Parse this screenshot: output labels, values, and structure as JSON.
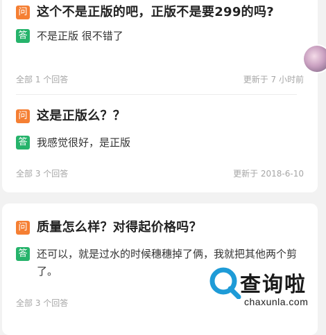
{
  "labels": {
    "question_tag": "问",
    "answer_tag": "答"
  },
  "questions": [
    {
      "question": "这个不是正版的吧，正版不是要299的吗?",
      "answer": "不是正版 很不错了",
      "answer_count": "全部 1 个回答",
      "updated": "更新于 7 小时前"
    },
    {
      "question": "这是正版么？？",
      "answer": "我感觉很好，是正版",
      "answer_count": "全部 3 个回答",
      "updated": "更新于 2018-6-10"
    },
    {
      "question": "质量怎么样？对得起价格吗？",
      "answer": "还可以，就是过水的时候穗穗掉了俩，我就把其他两个剪了。",
      "answer_count": "全部 3 个回答",
      "updated": ""
    }
  ],
  "watermark": {
    "title": "查询啦",
    "url": "chaxunla.com",
    "brand_color": "#1e9bd7"
  },
  "colors": {
    "question_tag": "#f57f33",
    "answer_tag": "#26b36b",
    "meta_text": "#a6a6a6"
  }
}
